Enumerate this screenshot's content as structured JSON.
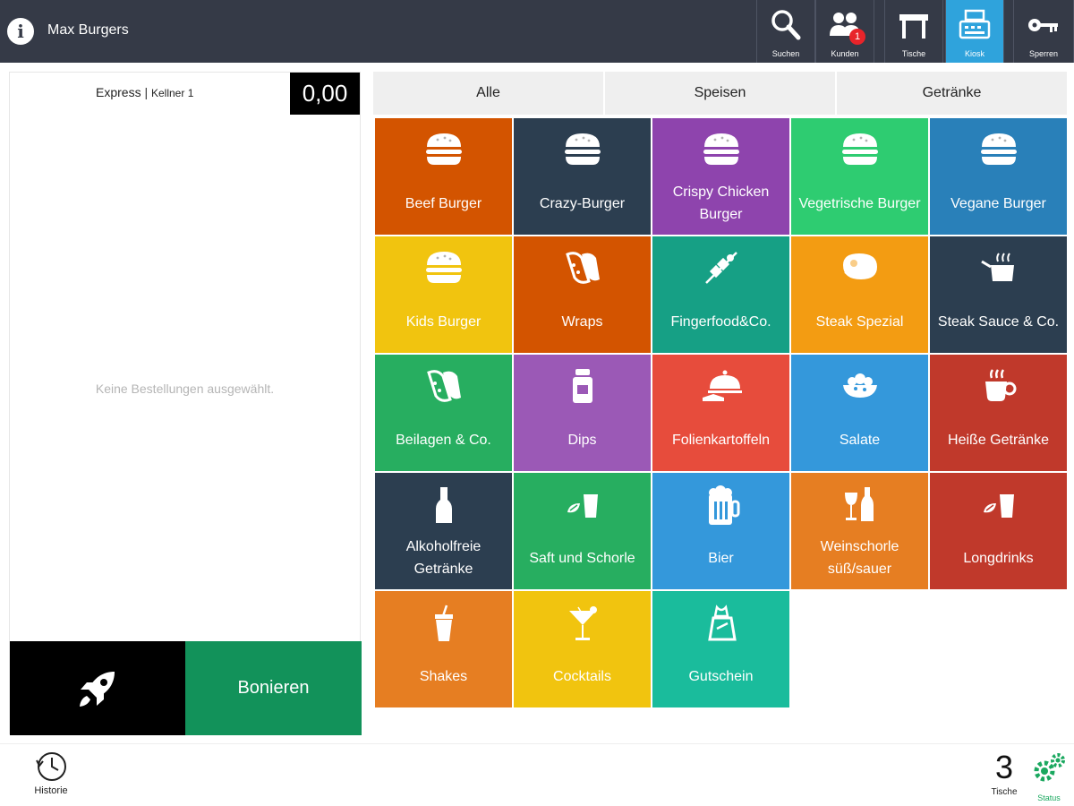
{
  "app": {
    "title": "Max Burgers"
  },
  "topbar": {
    "buttons": [
      {
        "label": "Suchen",
        "icon": "search-icon"
      },
      {
        "label": "Kunden",
        "icon": "customers-icon",
        "badge": "1"
      },
      {
        "label": "Tische",
        "icon": "table-icon"
      },
      {
        "label": "Kiosk",
        "icon": "cash-register-icon",
        "active": true
      },
      {
        "label": "Sperren",
        "icon": "key-icon"
      }
    ]
  },
  "order": {
    "mode": "Express",
    "separator": "|",
    "waiter": "Kellner 1",
    "total": "0,00",
    "empty_message": "Keine Bestellungen ausgewählt.",
    "submit_label": "Bonieren"
  },
  "tabs": [
    "Alle",
    "Speisen",
    "Getränke"
  ],
  "tiles": [
    {
      "label": "Beef Burger",
      "color": "#d35400",
      "icon": "burger-icon"
    },
    {
      "label": "Crazy-Burger",
      "color": "#2c3e50",
      "icon": "burger-icon"
    },
    {
      "label": "Crispy Chicken Burger",
      "color": "#8e44ad",
      "icon": "burger-icon"
    },
    {
      "label": "Vegetrische Burger",
      "color": "#2ecc71",
      "icon": "burger-icon"
    },
    {
      "label": "Vegane Burger",
      "color": "#2980b9",
      "icon": "burger-icon"
    },
    {
      "label": "Kids Burger",
      "color": "#f1c40f",
      "icon": "burger-icon"
    },
    {
      "label": "Wraps",
      "color": "#d35400",
      "icon": "wrap-icon"
    },
    {
      "label": "Fingerfood&Co.",
      "color": "#16a085",
      "icon": "skewer-icon"
    },
    {
      "label": "Steak Spezial",
      "color": "#f39c12",
      "icon": "steak-icon"
    },
    {
      "label": "Steak Sauce & Co.",
      "color": "#2c3e50",
      "icon": "saucepan-icon"
    },
    {
      "label": "Beilagen & Co.",
      "color": "#27ae60",
      "icon": "wrap-icon"
    },
    {
      "label": "Dips",
      "color": "#9b59b6",
      "icon": "jar-icon"
    },
    {
      "label": "Folienkartoffeln",
      "color": "#e74c3c",
      "icon": "cloche-icon"
    },
    {
      "label": "Salate",
      "color": "#3498db",
      "icon": "salad-icon"
    },
    {
      "label": "Heiße Getränke",
      "color": "#c0392b",
      "icon": "coffee-cup-icon"
    },
    {
      "label": "Alkoholfreie Getränke",
      "color": "#2c3e50",
      "icon": "bottle-icon"
    },
    {
      "label": "Saft und Schorle",
      "color": "#27ae60",
      "icon": "juice-icon"
    },
    {
      "label": "Bier",
      "color": "#3498db",
      "icon": "beer-icon"
    },
    {
      "label": "Weinschorle süß/sauer",
      "color": "#e67e22",
      "icon": "wine-icon"
    },
    {
      "label": "Longdrinks",
      "color": "#c0392b",
      "icon": "juice-icon"
    },
    {
      "label": "Shakes",
      "color": "#e67e22",
      "icon": "shake-icon"
    },
    {
      "label": "Cocktails",
      "color": "#f1c40f",
      "icon": "cocktail-icon"
    },
    {
      "label": "Gutschein",
      "color": "#1abc9c",
      "icon": "voucher-icon"
    }
  ],
  "bottombar": {
    "history_label": "Historie",
    "tables_count": "3",
    "tables_label": "Tische",
    "status_label": "Status"
  }
}
